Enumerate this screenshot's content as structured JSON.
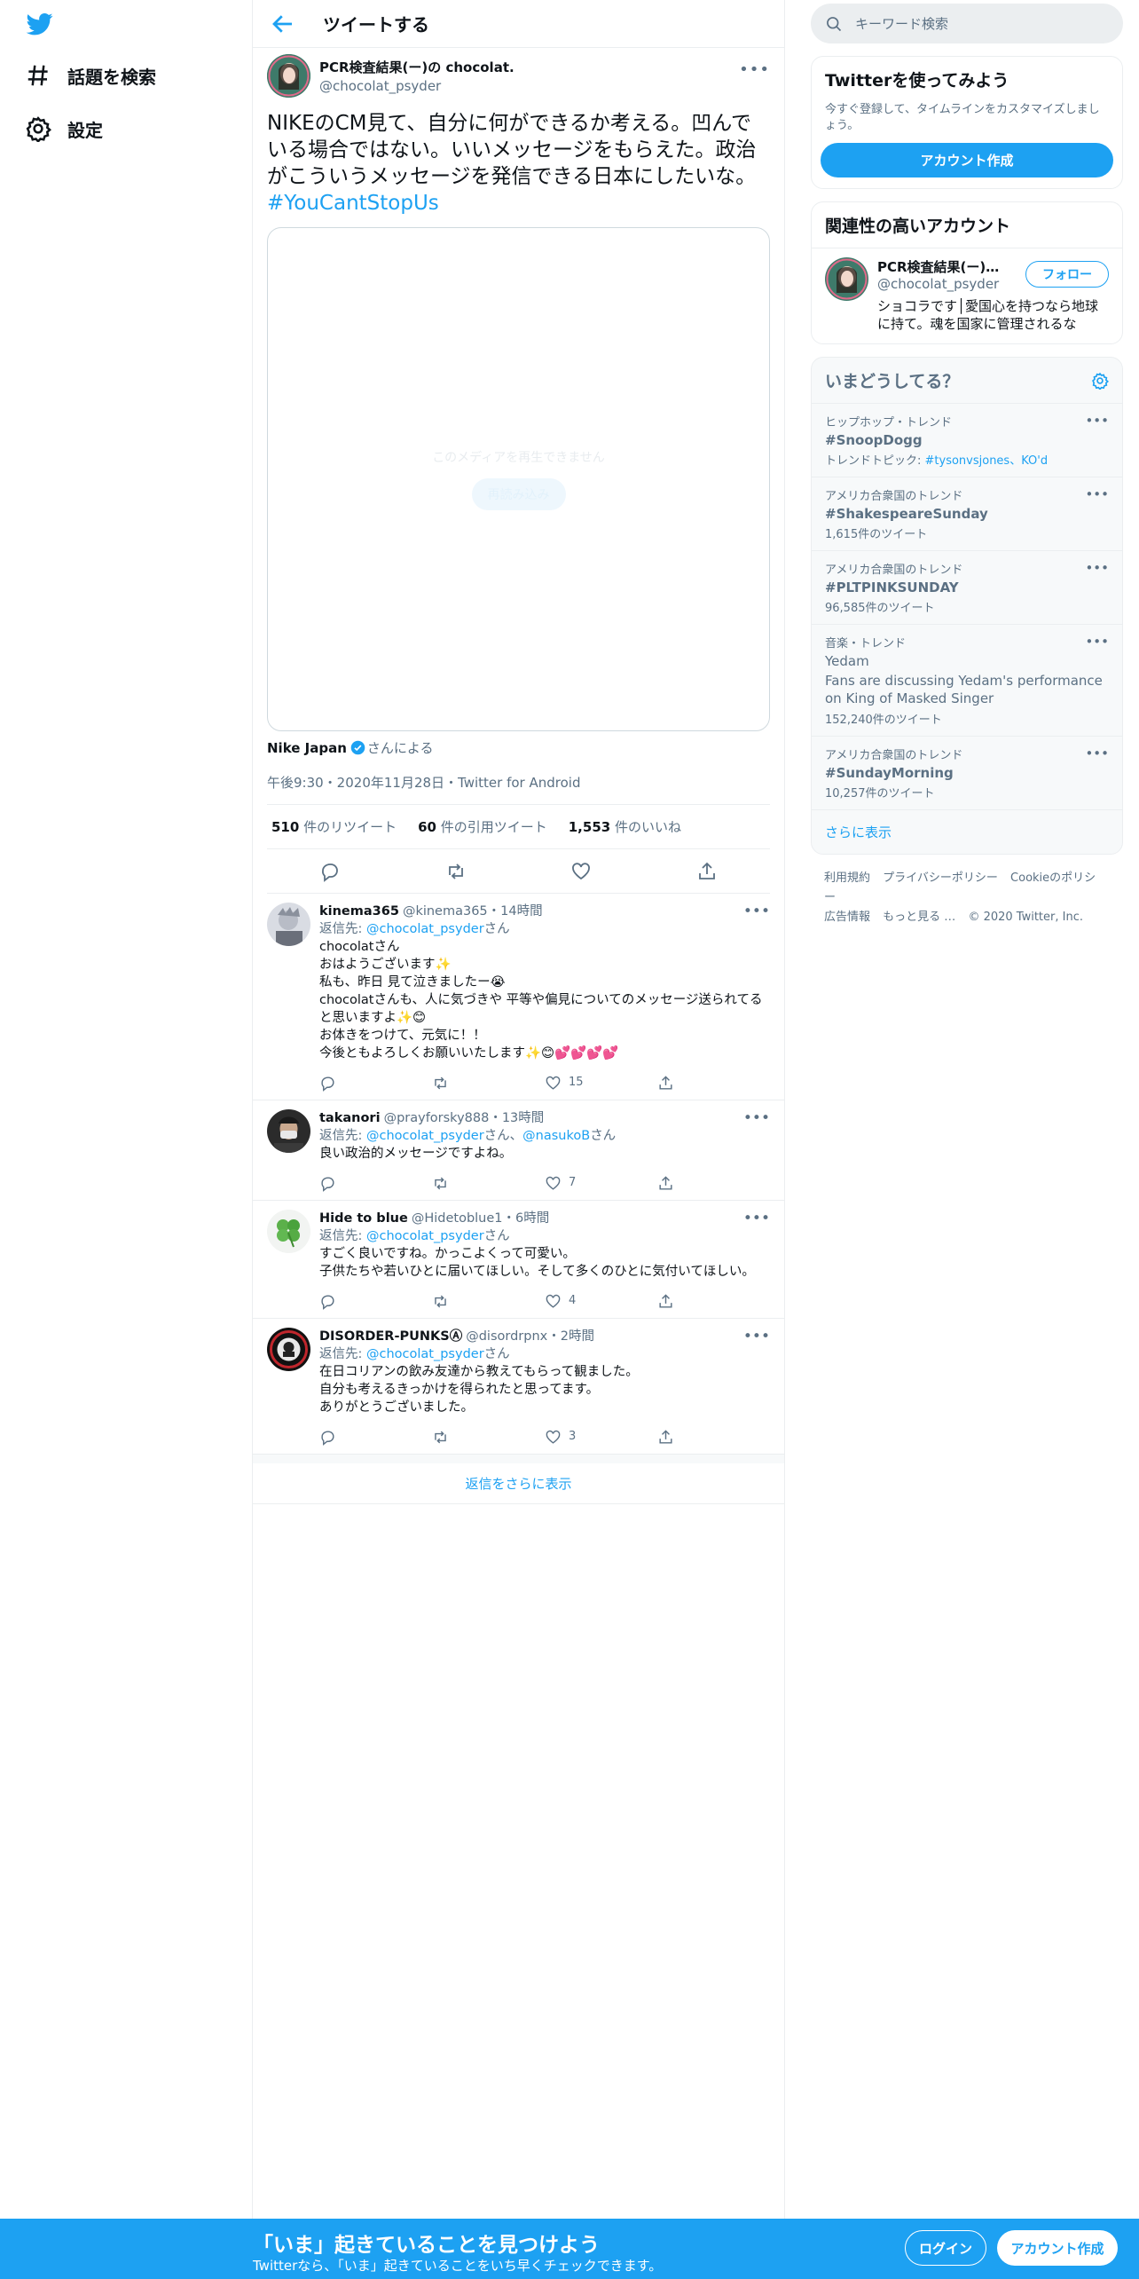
{
  "nav": {
    "explore_label": "話題を検索",
    "settings_label": "設定"
  },
  "header": {
    "title": "ツイートする"
  },
  "tweet": {
    "author_name": "PCR検査結果(ー)の chocolat.",
    "author_handle": "@chocolat_psyder",
    "text": "NIKEのCM見て、自分に何ができるか考える。凹んでいる場合ではない。いいメッセージをもらえた。政治がこういうメッセージを発信できる日本にしたいな。",
    "hashtag": "#YouCantStopUs",
    "media_message": "このメディアを再生できません",
    "media_button": "再読み込み",
    "promoted_by": "Nike Japan",
    "promoted_suffix": "さんによる",
    "meta": "午後9:30・2020年11月28日・Twitter for Android",
    "retweets": "510",
    "retweets_label": " 件のリツイート",
    "quotes": "60",
    "quotes_label": " 件の引用ツイート",
    "likes": "1,553",
    "likes_label": " 件のいいね"
  },
  "replies": [
    {
      "name": "kinema365",
      "handle": "@kinema365",
      "time": "・14時間",
      "reply_to_prefix": "返信先: ",
      "reply_to": "@chocolat_psyder",
      "reply_to_suffix": "さん",
      "text": "chocolatさん\nおはようございます✨\n私も、昨日 見て泣きましたー😭\nchocolatさんも、人に気づきや 平等や偏見についてのメッセージ送られてると思いますよ✨😊\nお体きをつけて、元気に！！\n今後ともよろしくお願いいたします✨😊💕💕💕💕",
      "likes": "15"
    },
    {
      "name": "takanori",
      "handle": "@prayforsky888",
      "time": "・13時間",
      "reply_to_prefix": "返信先: ",
      "reply_to": "@chocolat_psyder",
      "reply_to_suffix": "さん、",
      "reply_to2": "@nasukoB",
      "reply_to2_suffix": "さん",
      "text": "良い政治的メッセージですよね。",
      "likes": "7"
    },
    {
      "name": "Hide to blue",
      "handle": "@Hidetoblue1",
      "time": "・6時間",
      "reply_to_prefix": "返信先: ",
      "reply_to": "@chocolat_psyder",
      "reply_to_suffix": "さん",
      "text": "すごく良いですね。かっこよくって可愛い。\n子供たちや若いひとに届いてほしい。そして多くのひとに気付いてほしい。",
      "likes": "4"
    },
    {
      "name": "DISORDER-PUNKSⒶ",
      "handle": "@disordrpnx",
      "time": "・2時間",
      "reply_to_prefix": "返信先: ",
      "reply_to": "@chocolat_psyder",
      "reply_to_suffix": "さん",
      "text": "在日コリアンの飲み友達から教えてもらって観ました。\n自分も考えるきっかけを得られたと思ってます。\nありがとうございました。",
      "likes": "3"
    }
  ],
  "more_replies": "返信をさらに表示",
  "search": {
    "placeholder": "キーワード検索"
  },
  "signup_card": {
    "title": "Twitterを使ってみよう",
    "desc": "今すぐ登録して、タイムラインをカスタマイズしましょう。",
    "button": "アカウント作成"
  },
  "related": {
    "title": "関連性の高いアカウント",
    "name": "PCR検査結果(ー)の chocolat.",
    "handle": "@chocolat_psyder",
    "follow": "フォロー",
    "bio": "ショコラです│愛国心を持つなら地球に持て。魂を国家に管理されるな"
  },
  "trends": {
    "title": "いまどうしてる？",
    "items": [
      {
        "category": "ヒップホップ・トレンド",
        "name": "#SnoopDogg",
        "topic_prefix": "トレンドトピック: ",
        "topic": "#tysonvsjones、KO'd"
      },
      {
        "category": "アメリカ合衆国のトレンド",
        "name": "#ShakespeareSunday",
        "count": "1,615件のツイート"
      },
      {
        "category": "アメリカ合衆国のトレンド",
        "name": "#PLTPINKSUNDAY",
        "count": "96,585件のツイート"
      },
      {
        "category": "音楽・トレンド",
        "name": "Yedam",
        "desc": "Fans are discussing Yedam's performance on King of Masked Singer",
        "count": "152,240件のツイート"
      },
      {
        "category": "アメリカ合衆国のトレンド",
        "name": "#SundayMorning",
        "count": "10,257件のツイート"
      }
    ],
    "show_more": "さらに表示"
  },
  "footer": {
    "links": [
      "利用規約",
      "プライバシーポリシー",
      "Cookieのポリシー",
      "広告情報",
      "もっと見る …"
    ],
    "copyright": "© 2020 Twitter, Inc."
  },
  "bottom": {
    "title": "「いま」起きていることを見つけよう",
    "subtitle": "Twitterなら、「いま」起きていることをいち早くチェックできます。",
    "login": "ログイン",
    "signup": "アカウント作成"
  },
  "colors": {
    "accent": "#1da1f2",
    "text": "#0f1419",
    "secondary": "#5b7083"
  }
}
